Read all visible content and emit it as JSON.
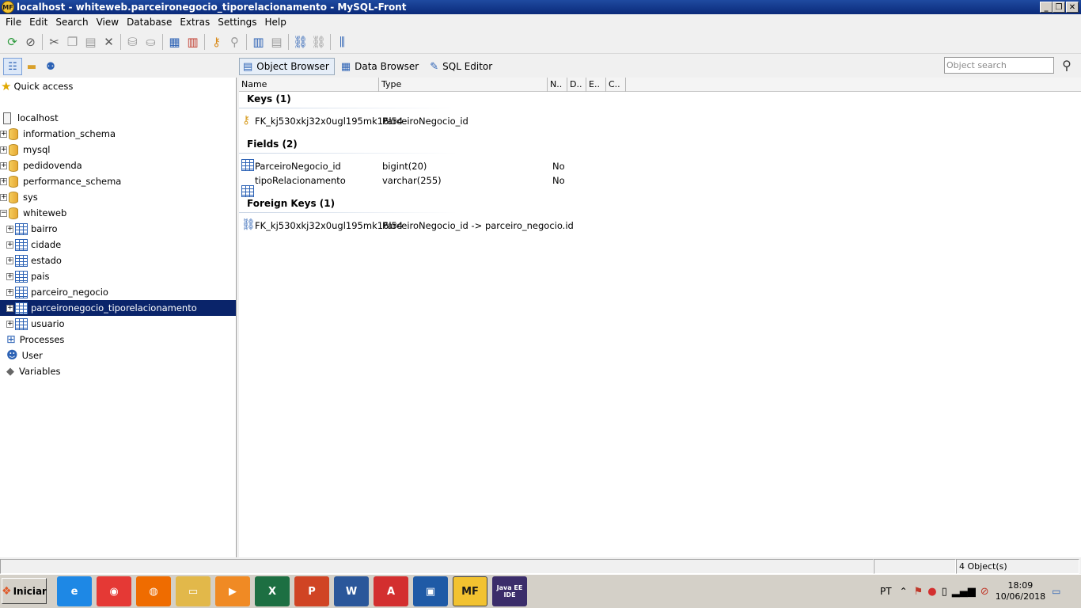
{
  "window": {
    "title": "localhost - whiteweb.parceironegocio_tiporelacionamento - MySQL-Front",
    "app_badge": "MF",
    "controls": [
      "_",
      "❐",
      "✕"
    ]
  },
  "menu": [
    "File",
    "Edit",
    "Search",
    "View",
    "Database",
    "Extras",
    "Settings",
    "Help"
  ],
  "tabs": [
    {
      "label": "Object Browser",
      "icon": "object-browser-icon",
      "active": true
    },
    {
      "label": "Data Browser",
      "icon": "data-browser-icon",
      "active": false
    },
    {
      "label": "SQL Editor",
      "icon": "sql-editor-icon",
      "active": false
    }
  ],
  "search": {
    "placeholder": "Object search"
  },
  "tree": {
    "quick_access": "Quick access",
    "host": "localhost",
    "databases": [
      "information_schema",
      "mysql",
      "pedidovenda",
      "performance_schema",
      "sys",
      "whiteweb"
    ],
    "tables": [
      "bairro",
      "cidade",
      "estado",
      "pais",
      "parceiro_negocio",
      "parceironegocio_tiporelacionamento",
      "usuario"
    ],
    "selected": "parceironegocio_tiporelacionamento",
    "extras": [
      "Processes",
      "User",
      "Variables"
    ]
  },
  "grid": {
    "columns": [
      "Name",
      "Type",
      "N..",
      "D..",
      "E..",
      "C.."
    ],
    "keys": {
      "header": "Keys (1)",
      "rows": [
        {
          "name": "FK_kj530xkj32x0ugl195mk16l54",
          "type": "ParceiroNegocio_id"
        }
      ]
    },
    "fields": {
      "header": "Fields (2)",
      "rows": [
        {
          "name": "ParceiroNegocio_id",
          "type": "bigint(20)",
          "null": "No"
        },
        {
          "name": "tipoRelacionamento",
          "type": "varchar(255)",
          "null": "No"
        }
      ]
    },
    "foreign_keys": {
      "header": "Foreign Keys (1)",
      "rows": [
        {
          "name": "FK_kj530xkj32x0ugl195mk16l54",
          "type": "ParceiroNegocio_id -> parceiro_negocio.id"
        }
      ]
    }
  },
  "status": {
    "objects": "4 Object(s)"
  },
  "taskbar": {
    "start": "Iniciar",
    "apps": [
      {
        "name": "internet-explorer",
        "glyph": "e",
        "color": "#1e88e5"
      },
      {
        "name": "chrome",
        "glyph": "◉",
        "color": "#e53935"
      },
      {
        "name": "firefox",
        "glyph": "◍",
        "color": "#ef6c00"
      },
      {
        "name": "explorer",
        "glyph": "▭",
        "color": "#e2b84a"
      },
      {
        "name": "media-player",
        "glyph": "▶",
        "color": "#f08a24"
      },
      {
        "name": "excel",
        "glyph": "X",
        "color": "#1d6f42"
      },
      {
        "name": "powerpoint",
        "glyph": "P",
        "color": "#d04424"
      },
      {
        "name": "word",
        "glyph": "W",
        "color": "#2b579a"
      },
      {
        "name": "acrobat",
        "glyph": "A",
        "color": "#d32f2f"
      },
      {
        "name": "virtualbox",
        "glyph": "▣",
        "color": "#1f5aa6"
      },
      {
        "name": "mysql-front",
        "glyph": "MF",
        "color": "#f2c230"
      },
      {
        "name": "java-ee-ide",
        "glyph": "Java EE IDE",
        "color": "#3b2d6a"
      }
    ],
    "language": "PT",
    "time": "18:09",
    "date": "10/06/2018"
  }
}
